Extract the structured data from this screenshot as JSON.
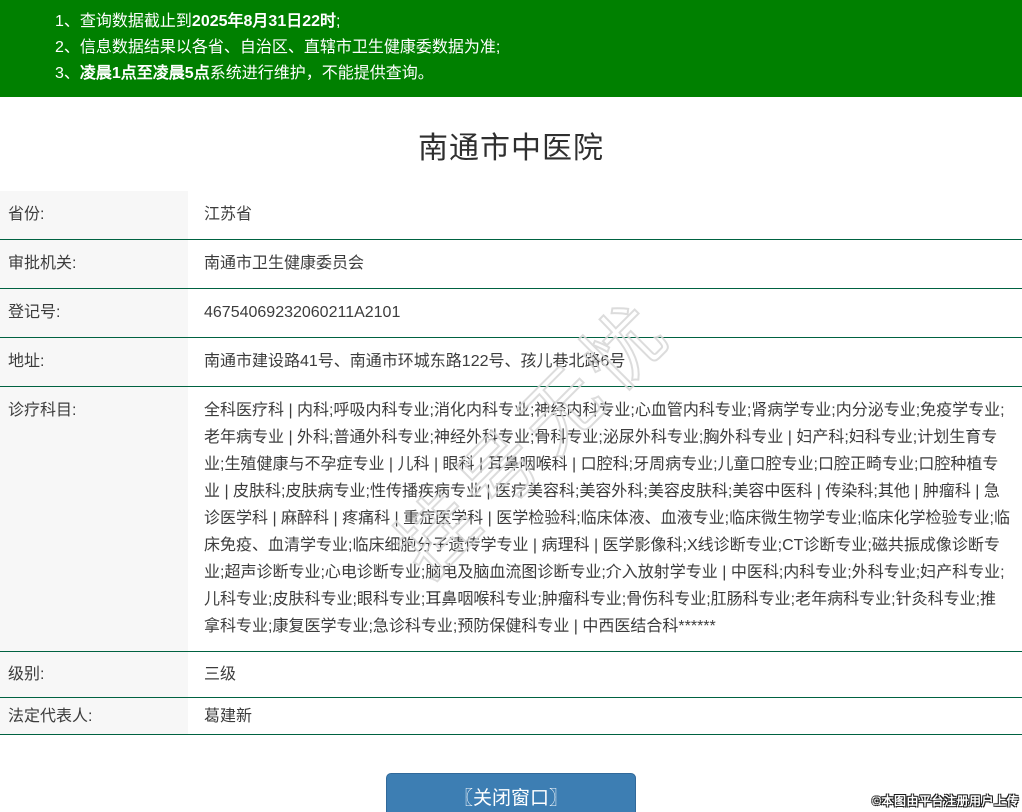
{
  "banner": {
    "bg_color": "#008000",
    "notices": [
      {
        "num": "1、",
        "pre": "查询数据截止到",
        "bold": "2025年8月31日22时",
        "post": ";"
      },
      {
        "num": "2、",
        "pre": "信息数据结果以各省、自治区、直辖市卫生健康委数据为准;",
        "bold": "",
        "post": ""
      },
      {
        "num": "3、",
        "pre": "",
        "bold": "凌晨1点至凌晨5点",
        "post": "系统进行维护，不能提供查询。"
      }
    ]
  },
  "page": {
    "title": "南通市中医院"
  },
  "table": {
    "divider_color": "#006241",
    "label_bg": "#f7f7f7",
    "rows": [
      {
        "label": "省份:",
        "value": "江苏省"
      },
      {
        "label": "审批机关:",
        "value": "南通市卫生健康委员会"
      },
      {
        "label": "登记号:",
        "value": "46754069232060211A2101"
      },
      {
        "label": "地址:",
        "value": "南通市建设路41号、南通市环城东路122号、孩儿巷北路6号"
      },
      {
        "label": "诊疗科目:",
        "value": "全科医疗科 | 内科;呼吸内科专业;消化内科专业;神经内科专业;心血管内科专业;肾病学专业;内分泌专业;免疫学专业;老年病专业 | 外科;普通外科专业;神经外科专业;骨科专业;泌尿外科专业;胸外科专业 | 妇产科;妇科专业;计划生育专业;生殖健康与不孕症专业 | 儿科 | 眼科 | 耳鼻咽喉科 | 口腔科;牙周病专业;儿童口腔专业;口腔正畸专业;口腔种植专业 | 皮肤科;皮肤病专业;性传播疾病专业 | 医疗美容科;美容外科;美容皮肤科;美容中医科 | 传染科;其他 | 肿瘤科 | 急诊医学科 | 麻醉科 | 疼痛科 | 重症医学科 | 医学检验科;临床体液、血液专业;临床微生物学专业;临床化学检验专业;临床免疫、血清学专业;临床细胞分子遗传学专业 | 病理科 | 医学影像科;X线诊断专业;CT诊断专业;磁共振成像诊断专业;超声诊断专业;心电诊断专业;脑电及脑血流图诊断专业;介入放射学专业 | 中医科;内科专业;外科专业;妇产科专业;儿科专业;皮肤科专业;眼科专业;耳鼻咽喉科专业;肿瘤科专业;骨伤科专业;肛肠科专业;老年病科专业;针灸科专业;推拿科专业;康复医学专业;急诊科专业;预防保健科专业 | 中西医结合科******"
      },
      {
        "label": "级别:",
        "value": "三级"
      },
      {
        "label": "法定代表人:",
        "value": "葛建新"
      }
    ]
  },
  "watermark": {
    "text": "挂号无忧"
  },
  "footer": {
    "close_button_label": "〖关闭窗口〗",
    "button_color": "#3d7eb3",
    "copyright": "©本图由平台注册用户上传"
  }
}
